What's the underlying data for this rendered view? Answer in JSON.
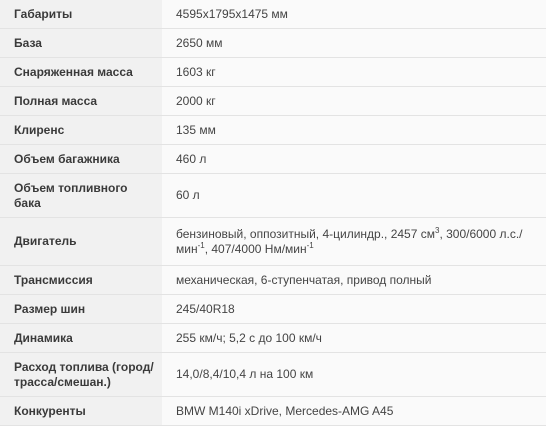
{
  "specs": [
    {
      "label": "Габариты",
      "value": "4595x1795x1475 мм"
    },
    {
      "label": "База",
      "value": "2650 мм"
    },
    {
      "label": "Снаряженная масса",
      "value": "1603 кг"
    },
    {
      "label": "Полная масса",
      "value": "2000 кг"
    },
    {
      "label": "Клиренс",
      "value": "135 мм"
    },
    {
      "label": "Объем багажника",
      "value": "460 л"
    },
    {
      "label": "Объем топливного бака",
      "value": "60 л"
    },
    {
      "label": "Двигатель",
      "value_parts": [
        "бензиновый, оппозитный, 4-цилиндр., 2457 см",
        "3",
        ", 300/6000 л.с./мин",
        "-1",
        ", 407/4000 Нм/мин",
        "-1"
      ]
    },
    {
      "label": "Трансмиссия",
      "value": "механическая, 6-ступенчатая, привод полный"
    },
    {
      "label": "Размер шин",
      "value": "245/40R18"
    },
    {
      "label": "Динамика",
      "value": "255 км/ч; 5,2 с до 100 км/ч"
    },
    {
      "label": "Расход топлива (город/трасса/смешан.)",
      "value": "14,0/8,4/10,4 л на 100 км"
    },
    {
      "label": "Конкуренты",
      "value": "BMW M140i xDrive, Mercedes-AMG A45"
    }
  ]
}
